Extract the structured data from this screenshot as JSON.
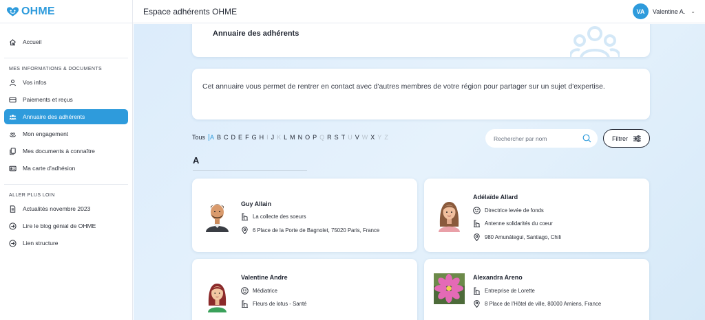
{
  "brand": {
    "logo_text": "OHME",
    "accent": "#2e9bdc"
  },
  "topbar": {
    "title": "Espace adhérents OHME",
    "user_initials": "VA",
    "user_name": "Valentine A."
  },
  "sidebar": {
    "home": "Accueil",
    "section1": "MES INFORMATIONS & DOCUMENTS",
    "items1": [
      "Vos infos",
      "Paiements et reçus",
      "Annuaire des adhérents",
      "Mon engagement",
      "Mes documents à connaître",
      "Ma carte d'adhésion"
    ],
    "section2": "ALLER PLUS LOIN",
    "items2": [
      "Actualités novembre 2023",
      "Lire le blog génial de OHME",
      "Lien structure"
    ]
  },
  "page": {
    "title": "Annuaire des adhérents",
    "intro": "Cet annuaire vous permet de rentrer en contact avec d'autres membres de votre région pour partager sur un sujet d'expertise."
  },
  "alphabet": {
    "all": "Tous",
    "letters": [
      "A",
      "B",
      "C",
      "D",
      "E",
      "F",
      "G",
      "H",
      "I",
      "J",
      "K",
      "L",
      "M",
      "N",
      "O",
      "P",
      "Q",
      "R",
      "S",
      "T",
      "U",
      "V",
      "W",
      "X",
      "Y",
      "Z"
    ]
  },
  "search": {
    "placeholder": "Rechercher par nom"
  },
  "filter": {
    "label": "Filtrer"
  },
  "group": {
    "letter": "A"
  },
  "members": [
    {
      "name": "Guy Allain",
      "organization": "La collecte des soeurs",
      "address": "6 Place de la Porte de Bagnolet, 75020 Paris, France"
    },
    {
      "name": "Adélaïde Allard",
      "job": "Directrice levée de fonds",
      "organization": "Antenne solidarités du coeur",
      "address": "980 Amunátegui, Santiago, Chili"
    },
    {
      "name": "Valentine Andre",
      "job": "Médiatrice",
      "organization": "Fleurs de lotus - Santé"
    },
    {
      "name": "Alexandra Areno",
      "organization": "Entreprise de Lorette",
      "address": "8 Place de l'Hôtel de ville, 80000 Amiens, France"
    }
  ]
}
